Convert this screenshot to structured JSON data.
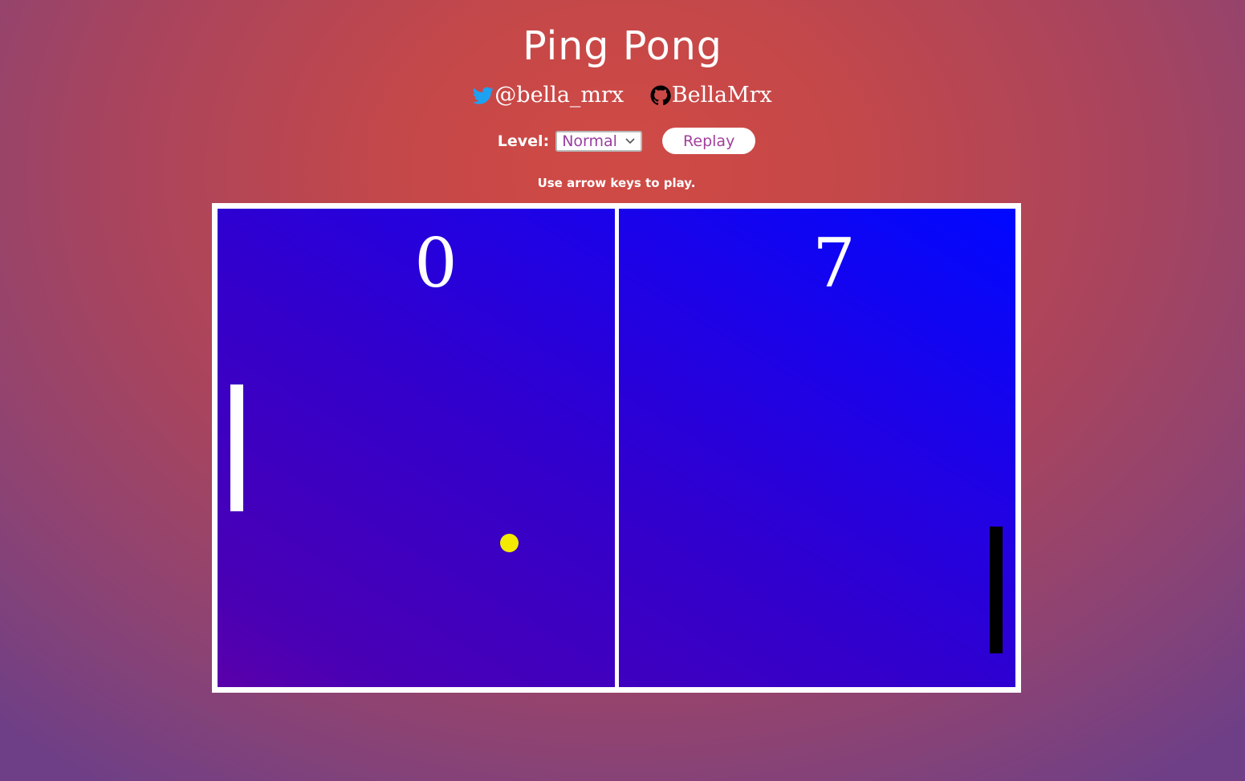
{
  "header": {
    "title": "Ping Pong"
  },
  "socials": {
    "twitter": {
      "label": "@bella_mrx",
      "icon": "twitter-icon",
      "color": "#1da1f2"
    },
    "github": {
      "label": "BellaMrx",
      "icon": "github-icon",
      "color": "#000000"
    }
  },
  "controls": {
    "level_label": "Level:",
    "level_selected": "Normal",
    "replay_label": "Replay"
  },
  "hint": "Use arrow keys to play.",
  "game": {
    "score_left": "0",
    "score_right": "7",
    "colors": {
      "court_top_right": "#0008ff",
      "court_bottom_left": "#5a00aa",
      "ball": "#f3ea00",
      "left_paddle": "#ffffff",
      "right_paddle": "#000000",
      "net": "#ffffff"
    }
  }
}
